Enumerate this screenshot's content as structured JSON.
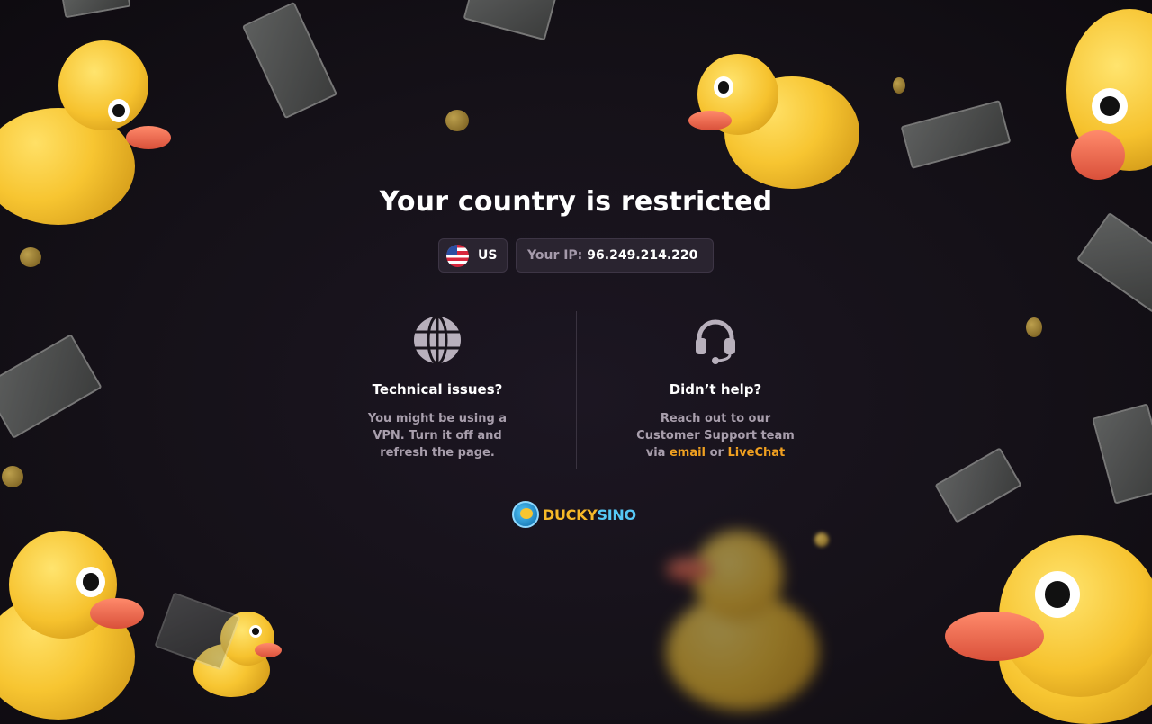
{
  "page": {
    "title": "Your country is restricted"
  },
  "location": {
    "flag_icon": "us-flag-icon",
    "country_code": "US",
    "ip_label": "Your IP:",
    "ip_value": "96.249.214.220"
  },
  "technical": {
    "icon": "globe-icon",
    "heading": "Technical issues?",
    "line1": "You might be using a",
    "line2": "VPN. Turn it off and",
    "line3": "refresh the page."
  },
  "support": {
    "icon": "headset-icon",
    "heading": "Didn’t help?",
    "line1": "Reach out to our",
    "line2": "Customer Support team",
    "via": "via",
    "email_link": "email",
    "or": "or",
    "chat_link": "LiveChat"
  },
  "brand": {
    "logo_part1": "DUCKY",
    "logo_part2": "SINO",
    "accent": "#f0a020",
    "secondary": "#56c8f5"
  }
}
